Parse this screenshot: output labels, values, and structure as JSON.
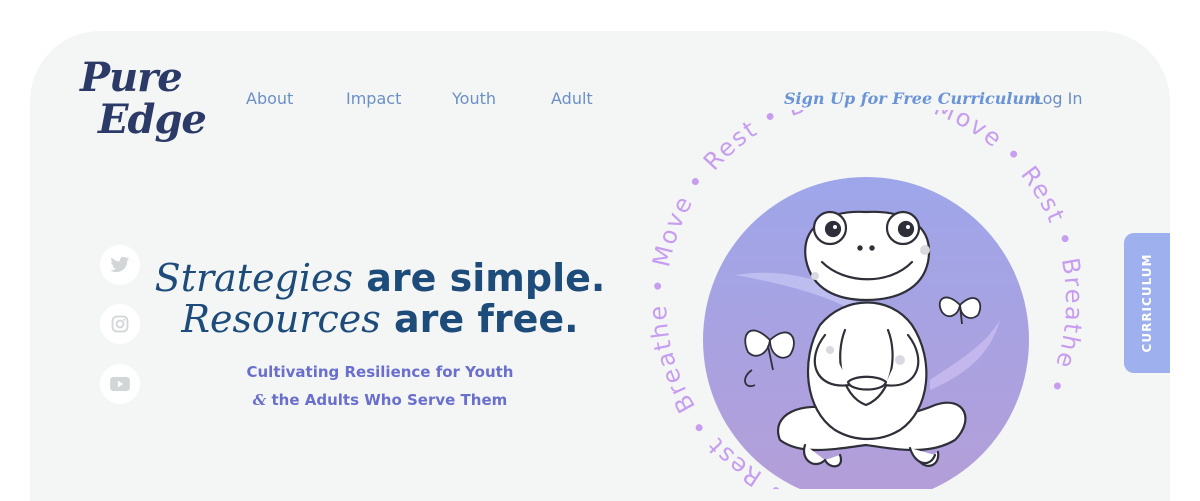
{
  "logo": {
    "line1": "Pure",
    "line2": "Edge"
  },
  "nav": {
    "items": [
      {
        "label": "About"
      },
      {
        "label": "Impact"
      },
      {
        "label": "Youth"
      },
      {
        "label": "Adult"
      }
    ],
    "signup_label": "Sign Up for Free Curriculum",
    "login_label": "Log In"
  },
  "social": {
    "icons": [
      "twitter-icon",
      "instagram-icon",
      "youtube-icon"
    ]
  },
  "hero": {
    "line1_italic": "Strategies",
    "line1_bold": " are simple.",
    "line2_italic": "Resources",
    "line2_bold": " are free.",
    "sub_line1": "Cultivating Resilience for Youth",
    "sub_line2_amp": "&",
    "sub_line2_rest": " the Adults Who Serve Them"
  },
  "ring_text": "Move • Rest • Breathe • Move • Rest • Breathe • Move • Rest • Breathe •",
  "curriculum_tab": "CURRICULUM",
  "colors": {
    "accent": "#6a94d6",
    "headline": "#1d4b7a",
    "circle_top": "#9ea6ea",
    "circle_bottom": "#b49ed8",
    "ring_text": "#c79df0",
    "tab": "#9eb0ee"
  }
}
